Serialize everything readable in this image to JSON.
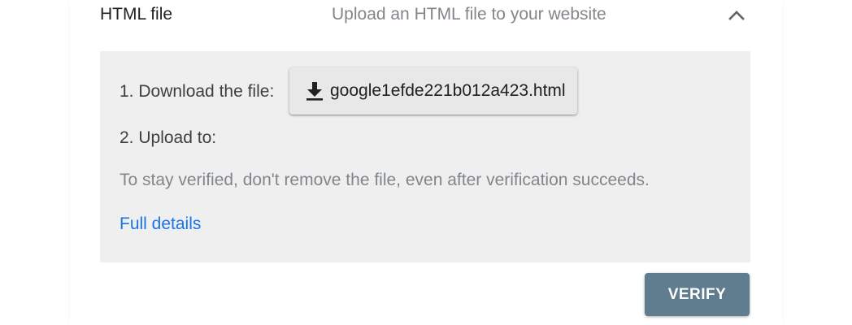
{
  "method": {
    "title": "HTML file",
    "description": "Upload an HTML file to your website",
    "collapse_icon": "chevron-up-icon"
  },
  "steps": {
    "download_label": "1. Download the file:",
    "download_file": "google1efde221b012a423.html",
    "download_icon": "download-icon",
    "upload_label": "2. Upload to:"
  },
  "note": "To stay verified, don't remove the file, even after verification succeeds.",
  "link": {
    "label": "Full details"
  },
  "actions": {
    "verify_label": "VERIFY"
  },
  "colors": {
    "panel_bg": "#efefef",
    "link": "#1a73e8",
    "verify_bg": "#5f7d8e"
  }
}
